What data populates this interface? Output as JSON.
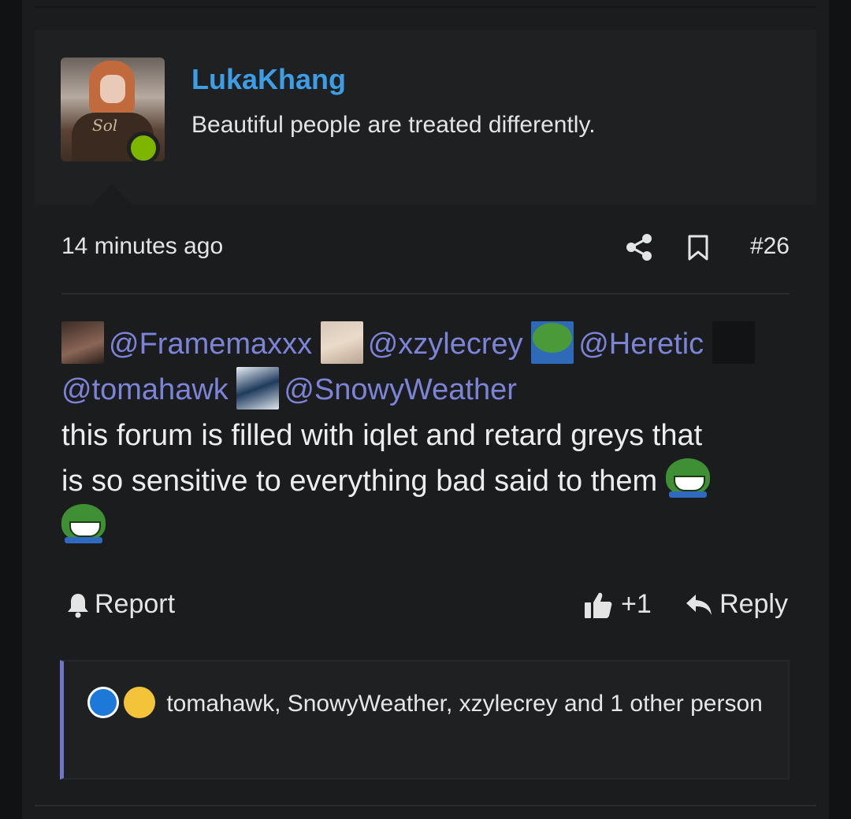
{
  "colors": {
    "username": "#3d9ee6",
    "mention": "#7b84d6",
    "online": "#7db500",
    "reaction_bar": "#6e74c8",
    "background": "#1b1c1e"
  },
  "user": {
    "name": "LukaKhang",
    "title": "Beautiful people are treated differently.",
    "avatar_icon": "user-avatar",
    "status": "online"
  },
  "meta": {
    "timestamp": "14 minutes ago",
    "post_number": "#26",
    "share_icon": "share-icon",
    "bookmark_icon": "bookmark-icon"
  },
  "content": {
    "mentions": [
      {
        "label": "@Framemaxxx",
        "avatar": "framemaxxx-avatar"
      },
      {
        "label": "@xzylecrey",
        "avatar": "xzylecrey-avatar"
      },
      {
        "label": "@Heretic",
        "avatar": "heretic-avatar"
      },
      {
        "label": "@tomahawk",
        "avatar": "tomahawk-avatar"
      },
      {
        "label": "@SnowyWeather",
        "avatar": "snowyweather-avatar"
      }
    ],
    "body_line1": "this forum is filled with iqlet and retard greys that",
    "body_line2": "is so sensitive to everything bad said to them",
    "emojis": [
      "pepe-laugh-emoji",
      "pepe-laugh-emoji"
    ]
  },
  "actions": {
    "report_label": "Report",
    "like_count": "+1",
    "reply_label": "Reply"
  },
  "reactions": {
    "icons": [
      "like-reaction-icon",
      "crying-laughing-reaction-icon"
    ],
    "summary": "tomahawk, SnowyWeather, xzylecrey and 1 other person"
  }
}
